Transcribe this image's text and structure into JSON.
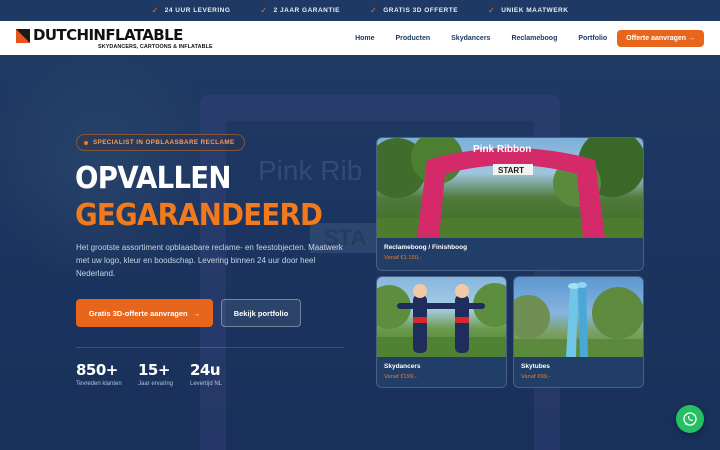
{
  "topbar": {
    "items": [
      {
        "icon": "check-icon",
        "label": "24 UUR LEVERING"
      },
      {
        "icon": "check-icon",
        "label": "2 JAAR GARANTIE"
      },
      {
        "icon": "check-icon",
        "label": "GRATIS 3D OFFERTE"
      },
      {
        "icon": "check-icon",
        "label": "UNIEK MAATWERK"
      }
    ]
  },
  "header": {
    "logo": {
      "part1": "DUTCH",
      "part2": "INFLATABLE",
      "tagline": "SKYDANCERS, CARTOONS & INFLATABLE"
    },
    "nav": [
      {
        "label": "Home"
      },
      {
        "label": "Producten"
      },
      {
        "label": "Skydancers"
      },
      {
        "label": "Reclameboog"
      },
      {
        "label": "Portfolio"
      }
    ],
    "cta": "Offerte aanvragen →"
  },
  "hero": {
    "badge": "SPECIALIST IN OPBLAASBARE RECLAME",
    "title_line1": "OPVALLEN",
    "title_line2": "GEGARANDEERD",
    "description": "Het grootste assortiment opblaasbare reclame- en feestobjecten. Maatwerk met uw logo, kleur en boodschap. Levering binnen 24 uur door heel Nederland.",
    "primary_button": "Gratis 3D-offerte aanvragen",
    "primary_button_arrow": "→",
    "secondary_button": "Bekijk portfolio",
    "background_text": {
      "ribbon": "Pink Rib",
      "start": "STA"
    },
    "stats": [
      {
        "value": "850+",
        "label": "Tevreden klanten"
      },
      {
        "value": "15+",
        "label": "Jaar ervaring"
      },
      {
        "value": "24u",
        "label": "Levertijd NL"
      }
    ]
  },
  "products": [
    {
      "title": "Reclameboog / Finishboog",
      "price": "Vanaf €1.150,-",
      "photo_text": "Pink Ribbon",
      "photo_start": "START"
    },
    {
      "title": "Skydancers",
      "price": "Vanaf €199,-"
    },
    {
      "title": "Skytubes",
      "price": "Vanaf €99,-"
    }
  ],
  "colors": {
    "accent": "#e8651c",
    "navy": "#1e3a64",
    "whatsapp": "#25c062"
  }
}
